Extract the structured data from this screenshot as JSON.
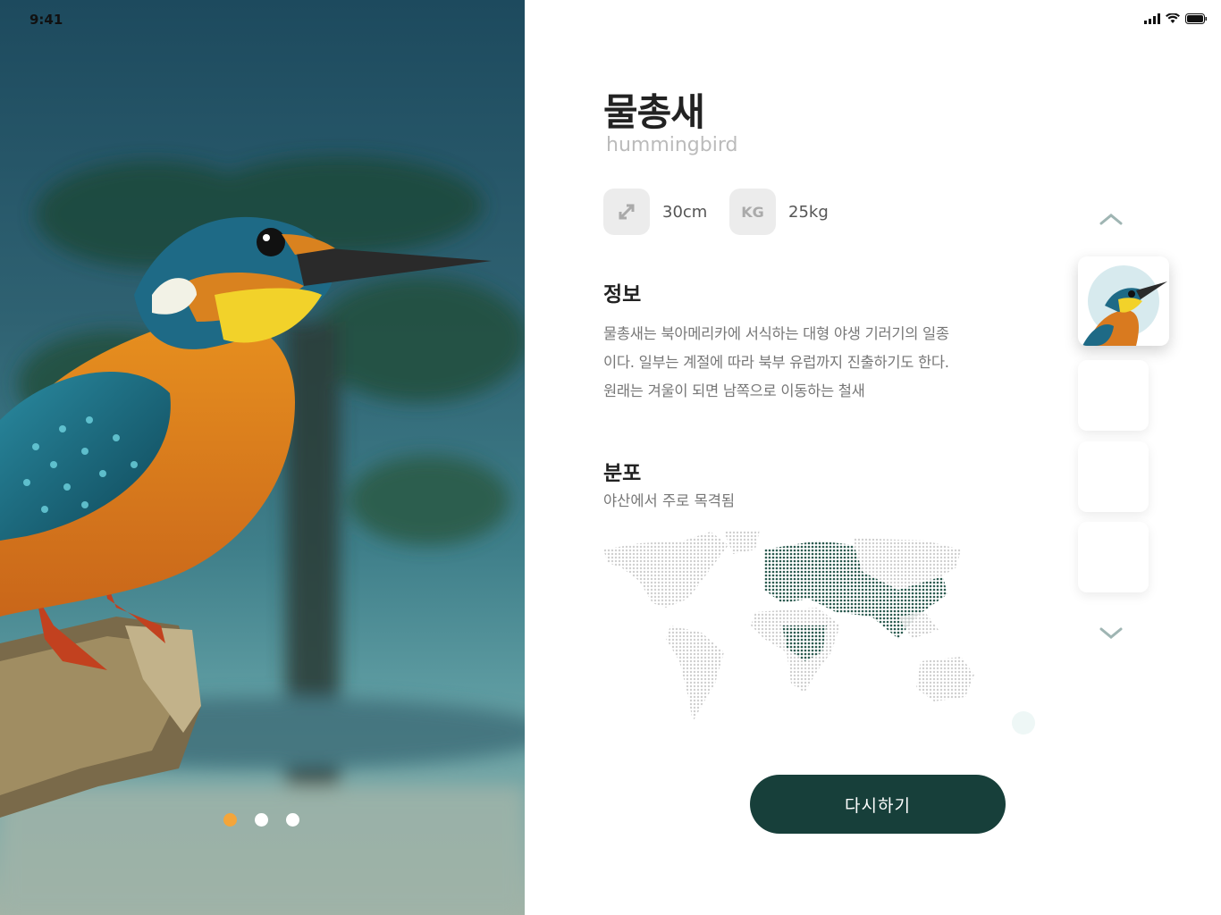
{
  "status": {
    "time": "9:41"
  },
  "bird": {
    "name_ko": "물총새",
    "name_en": "hummingbird"
  },
  "specs": [
    {
      "icon": "resize-arrows-icon",
      "value": "30cm"
    },
    {
      "icon": "kg-weight-icon",
      "icon_text": "KG",
      "value": "25kg"
    }
  ],
  "info": {
    "title": "정보",
    "text": "물총새는 북아메리카에 서식하는 대형 야생 기러기의 일종이다. 일부는 계절에 따라 북부 유럽까지 진출하기도 한다. 원래는 겨울이 되면 남쪽으로 이동하는 철새"
  },
  "distribution": {
    "title": "분포",
    "subtitle": "야산에서 주로 목격됨"
  },
  "actions": {
    "retry_label": "다시하기"
  },
  "carousel": {
    "active_index": 0,
    "count": 3
  },
  "thumbnails": {
    "count": 4,
    "selected_index": 0
  },
  "colors": {
    "accent": "#f4a53a",
    "primary": "#173f3a",
    "map_highlight": "#2b5a4f",
    "map_base": "#cfcfcf"
  }
}
